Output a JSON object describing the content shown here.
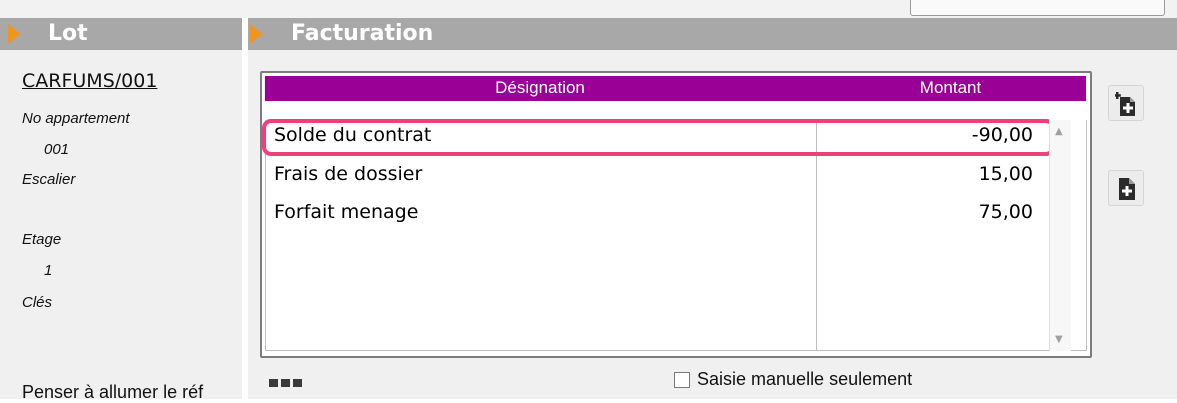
{
  "lot": {
    "title": "Lot",
    "reference": "CARFUMS/001",
    "fields": [
      {
        "label": "No appartement",
        "value": "001"
      },
      {
        "label": "Escalier",
        "value": ""
      },
      {
        "label": "Etage",
        "value": "1"
      },
      {
        "label": "Clés",
        "value": ""
      }
    ],
    "note": "Penser à allumer le réf"
  },
  "facturation": {
    "title": "Facturation",
    "columns": [
      "Désignation",
      "Montant"
    ],
    "rows": [
      {
        "designation": "Solde du contrat",
        "montant": "-90,00",
        "highlighted": true
      },
      {
        "designation": "Frais de dossier",
        "montant": "15,00",
        "highlighted": false
      },
      {
        "designation": "Forfait menage",
        "montant": "75,00",
        "highlighted": false
      }
    ],
    "manual_only_label": "Saisie manuelle seulement",
    "manual_only_checked": false
  },
  "colors": {
    "header_bg": "#a8a8a8",
    "accent_arrow": "#f0961e",
    "grid_header": "#9a0096",
    "highlight": "#f0407a"
  },
  "icons": {
    "insert_row": "insert-row-icon",
    "add_row": "add-row-icon",
    "more": "more-dots-icon"
  }
}
